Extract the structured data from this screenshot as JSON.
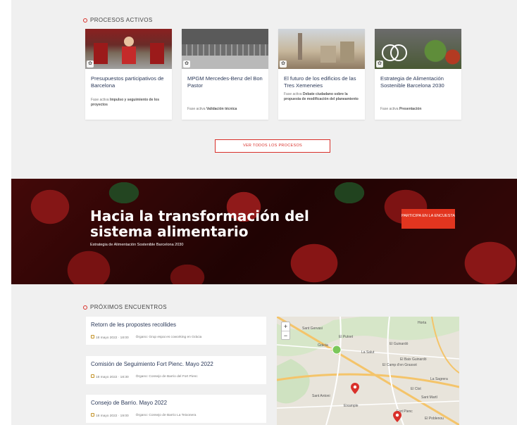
{
  "processes": {
    "heading": "PROCESOS ACTIVOS",
    "cards": [
      {
        "title": "Presupuestos participativos de Barcelona",
        "phase_prefix": "Fase activa",
        "phase_name": "Impulso y seguimiento de los proyectos"
      },
      {
        "title": "MPGM Mercedes-Benz del Bon Pastor",
        "phase_prefix": "Fase activa",
        "phase_name": "Validación técnica"
      },
      {
        "title": "El futuro de los edificios de las Tres Xemeneies",
        "phase_prefix": "Fase activa",
        "phase_name": "Debate ciudadano sobre la propuesta de modificación del planeamiento"
      },
      {
        "title": "Estrategia de Alimentación Sostenible Barcelona 2030",
        "phase_prefix": "Fase activa",
        "phase_name": "Presentación"
      }
    ],
    "see_all_label": "VER TODOS LOS PROCESOS"
  },
  "hero": {
    "title": "Hacia la transformación del sistema alimentario",
    "subtitle": "Estrategia de Alimentación Sostenible Barcelona 2030",
    "cta_label": "PARTICIPA EN LA ENCUESTA"
  },
  "meetings": {
    "heading": "PRÓXIMOS ENCUENTROS",
    "items": [
      {
        "title": "Retorn de les propostes recollides",
        "datetime": "18 mayo 2022 · 18:00",
        "organ_label": "Órgano:",
        "organ": "Grup espai es coworking en Gràcia"
      },
      {
        "title": "Comisión de Seguimiento Fort Pienc. Mayo 2022",
        "datetime": "18 mayo 2022 · 18:30",
        "organ_label": "Órgano:",
        "organ": "Consejo de Barrio del Fort Pienc"
      },
      {
        "title": "Consejo de Barrio. Mayo 2022",
        "datetime": "18 mayo 2022 · 19:00",
        "organ_label": "Órgano:",
        "organ": "Consejo de Barrio La Teixonera"
      }
    ]
  },
  "map": {
    "zoom_in": "+",
    "zoom_out": "−",
    "labels": [
      "Sant Gervasi",
      "Gràcia",
      "El Putxet",
      "Horta",
      "La Salut",
      "El Guinardó",
      "El Camp d'en Grassot",
      "El Baix Guinardó",
      "Sant Antoni",
      "Fort Pienc",
      "La Sagrera",
      "Sant Martí",
      "Eixample",
      "El Clot",
      "El Poblenou"
    ]
  }
}
